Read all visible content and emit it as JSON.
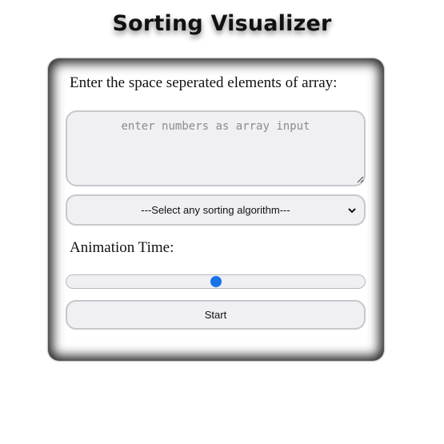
{
  "header": {
    "title": "Sorting Visualizer"
  },
  "form": {
    "array_label": "Enter the space seperated elements of array:",
    "array_input": {
      "value": "",
      "placeholder": "enter numbers as array input"
    },
    "algorithm_select": {
      "selected_label": "---Select any sorting algorithm---"
    },
    "animation_label": "Animation Time:",
    "animation_slider": {
      "value_fraction": 0.5
    },
    "start_button_label": "Start"
  },
  "colors": {
    "accent": "#1a73e8",
    "field_background": "#efeff4",
    "field_border": "#c7c7cc"
  },
  "icons": {
    "select_arrow": "chevron-down-icon",
    "textarea_resize": "resize-grip-icon"
  }
}
